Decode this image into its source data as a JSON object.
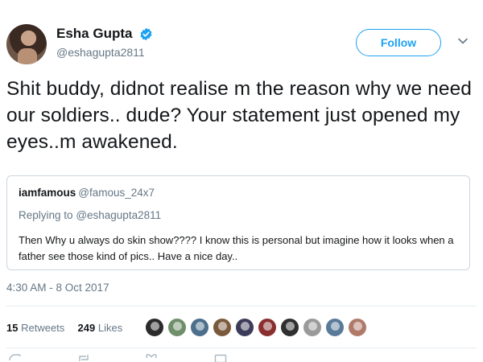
{
  "tweet": {
    "display_name": "Esha Gupta",
    "handle": "@eshagupta2811",
    "follow_label": "Follow",
    "text": "Shit buddy, didnot realise m the reason why we need our soldiers.. dude? Your statement just opened my eyes..m awakened.",
    "timestamp": "4:30 AM - 8 Oct 2017",
    "retweets_count": "15",
    "retweets_label": "Retweets",
    "likes_count": "249",
    "likes_label": "Likes"
  },
  "quoted": {
    "display_name": "iamfamous",
    "handle": "@famous_24x7",
    "replying_prefix": "Replying to",
    "replying_to": "@eshagupta2811",
    "text": "Then Why u always do skin show???? I know this is personal but imagine how it looks when a father see those kind of pics.. Have a nice day.."
  },
  "likers": {
    "avatar_colors": [
      "#2b2b2b",
      "#6f8f6a",
      "#4d6f8c",
      "#7a5a3c",
      "#3c3c5a",
      "#8a2f2f",
      "#2f2f2f",
      "#9a9a9a",
      "#5a7a9a",
      "#b07a6a"
    ]
  },
  "icons": {
    "verified": "verified-badge-icon",
    "more": "chevron-down-icon",
    "reply": "reply-icon",
    "retweet": "retweet-icon",
    "like": "heart-icon",
    "message": "message-icon"
  },
  "colors": {
    "brand": "#1da1f2",
    "text": "#14171a",
    "secondary": "#657786",
    "border": "#ccd6dd"
  }
}
